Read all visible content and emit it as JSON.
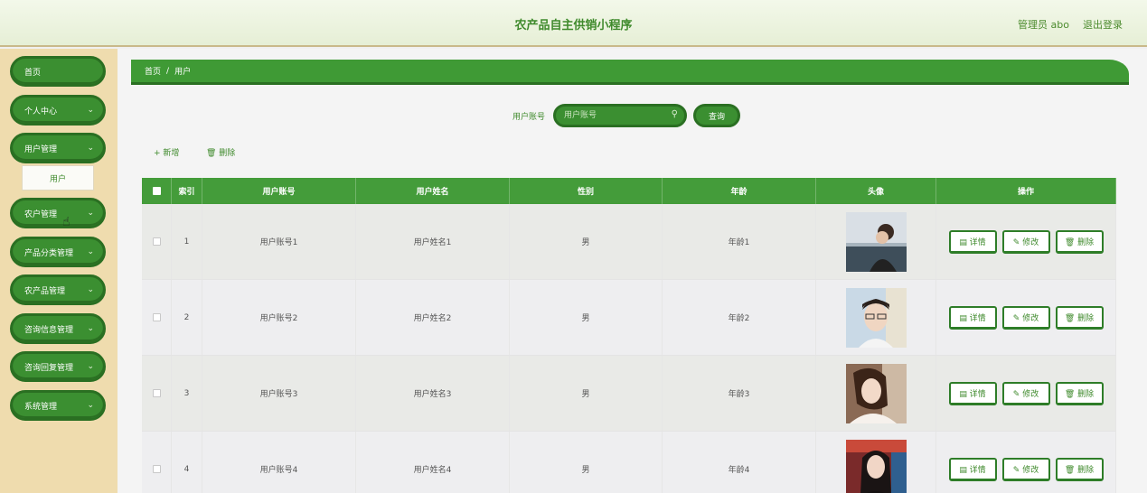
{
  "header": {
    "title": "农产品自主供销小程序",
    "user": "管理员 abo",
    "logout": "退出登录"
  },
  "sidebar": {
    "items": [
      {
        "label": "首页",
        "chevron": ""
      },
      {
        "label": "个人中心",
        "chevron": "⌄"
      },
      {
        "label": "用户管理",
        "chevron": "⌄"
      },
      {
        "label": "农户管理",
        "chevron": "⌄"
      },
      {
        "label": "产品分类管理",
        "chevron": "⌄"
      },
      {
        "label": "农产品管理",
        "chevron": "⌄"
      },
      {
        "label": "咨询信息管理",
        "chevron": "⌄"
      },
      {
        "label": "咨询回复管理",
        "chevron": "⌄"
      },
      {
        "label": "系统管理",
        "chevron": "⌄"
      }
    ],
    "submenu": {
      "label": "用户"
    }
  },
  "breadcrumb": {
    "home": "首页",
    "sep": "/",
    "current": "用户"
  },
  "search": {
    "label": "用户账号",
    "placeholder": "用户账号",
    "button": "查询"
  },
  "actions": {
    "add": "+ 新增",
    "delete": "🗑 删除"
  },
  "table": {
    "columns": [
      "索引",
      "用户账号",
      "用户姓名",
      "性别",
      "年龄",
      "头像",
      "操作"
    ],
    "ops": {
      "detail": "▤ 详情",
      "edit": "✎ 修改",
      "delete": "🗑 删除"
    },
    "rows": [
      {
        "index": "1",
        "account": "用户账号1",
        "name": "用户姓名1",
        "gender": "男",
        "age": "年龄1"
      },
      {
        "index": "2",
        "account": "用户账号2",
        "name": "用户姓名2",
        "gender": "男",
        "age": "年龄2"
      },
      {
        "index": "3",
        "account": "用户账号3",
        "name": "用户姓名3",
        "gender": "男",
        "age": "年龄3"
      },
      {
        "index": "4",
        "account": "用户账号4",
        "name": "用户姓名4",
        "gender": "男",
        "age": "年龄4"
      }
    ]
  },
  "colors": {
    "primary": "#3b8f31",
    "primary_dark": "#2a6f22",
    "sidebar_bg": "#efdcae",
    "header_bg": "#eef5e3"
  }
}
